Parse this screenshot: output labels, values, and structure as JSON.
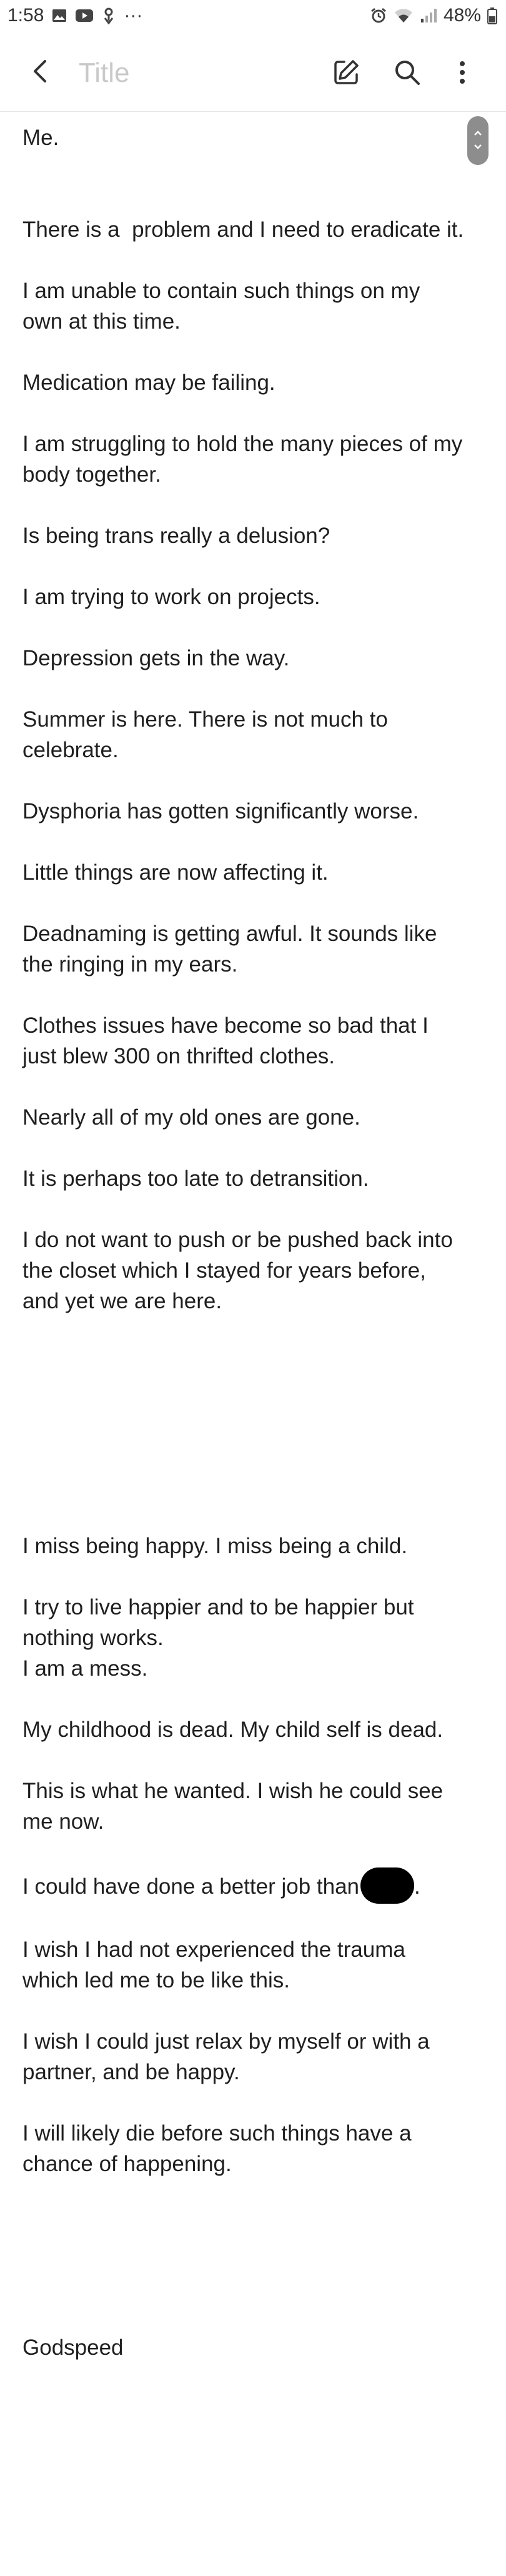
{
  "status_bar": {
    "time": "1:58",
    "more_indicator": "···",
    "battery": "48%",
    "left_icons": [
      "gallery-icon",
      "youtube-icon",
      "thread-icon"
    ],
    "right_icons": [
      "alarm-icon",
      "wifi-icon",
      "signal-icon",
      "battery-icon"
    ]
  },
  "toolbar": {
    "title_placeholder": "Title",
    "title_value": "",
    "back_icon": "back-arrow-icon",
    "edit_icon": "edit-icon",
    "search_icon": "search-icon",
    "more_icon": "more-vertical-icon"
  },
  "note": {
    "lines": [
      "Me.",
      "",
      "",
      "There is a  problem and I need to eradicate it.",
      "",
      "I am unable to contain such things on my",
      "own at this time.",
      "",
      "Medication may be failing.",
      "",
      "I am struggling to hold the many pieces of my",
      "body together.",
      "",
      "Is being trans really a delusion?",
      "",
      "I am trying to work on projects.",
      "",
      "Depression gets in the way.",
      "",
      "Summer is here. There is not much to",
      "celebrate.",
      "",
      "Dysphoria has gotten significantly worse.",
      "",
      "Little things are now affecting it.",
      "",
      "Deadnaming is getting awful. It sounds like",
      "the ringing in my ears.",
      "",
      "Clothes issues have become so bad that I",
      "just blew 300 on thrifted clothes.",
      "",
      "Nearly all of my old ones are gone.",
      "",
      "It is perhaps too late to detransition.",
      "",
      "I do not want to push or be pushed back into",
      "the closet which I stayed for years before,",
      "and yet we are here.",
      "",
      "",
      "",
      "",
      "",
      "",
      "",
      "I miss being happy. I miss being a child.",
      "",
      "I try to live happier and to be happier but",
      "nothing works.",
      "I am a mess.",
      "",
      "My childhood is dead. My child self is dead.",
      "",
      "This is what he wanted. I wish he could see",
      "me now.",
      "",
      "I could have done a better job than",
      "",
      "I wish I had not experienced the trauma",
      "which led me to be like this.",
      "",
      "I wish I could just relax by myself or with a",
      "partner, and be happy.",
      "",
      "I will likely die before such things have a",
      "chance of happening.",
      "",
      "",
      "",
      "",
      "",
      "Godspeed"
    ],
    "redacted_line_index": 57,
    "redacted_suffix": "."
  }
}
